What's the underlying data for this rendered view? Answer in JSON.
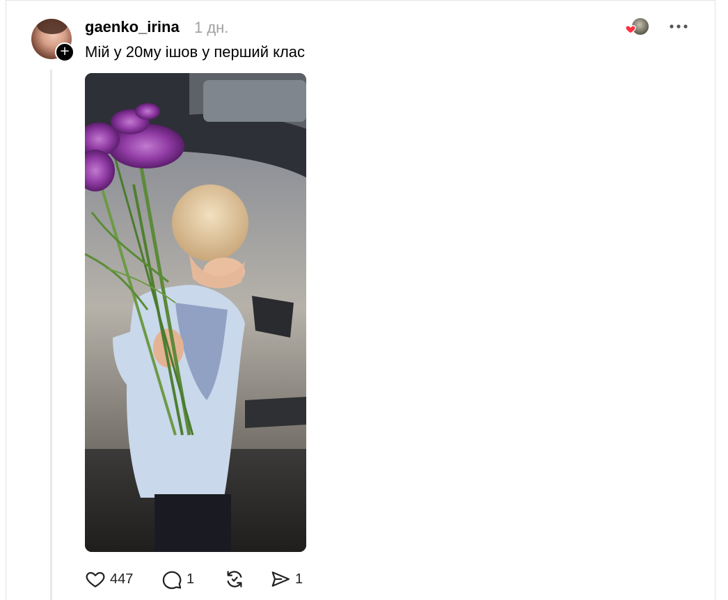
{
  "post": {
    "username": "gaenko_irina",
    "timestamp": "1 дн.",
    "text": "Мій у 20му ішов у перший клас",
    "follow_symbol": "+",
    "photo_alt": "photo",
    "actions": {
      "like_count": "447",
      "reply_count": "1",
      "share_count": "1"
    }
  },
  "icons": {
    "like": "heart-outline-icon",
    "reply": "speech-bubble-icon",
    "repost": "repost-arrows-icon",
    "share": "paper-plane-icon",
    "more": "ellipsis-icon",
    "liked_by": "red-heart-icon"
  },
  "colors": {
    "heart_red": "#ff3040",
    "timestamp_gray": "#a0a0a0",
    "thread_line": "#e8e8e8"
  }
}
